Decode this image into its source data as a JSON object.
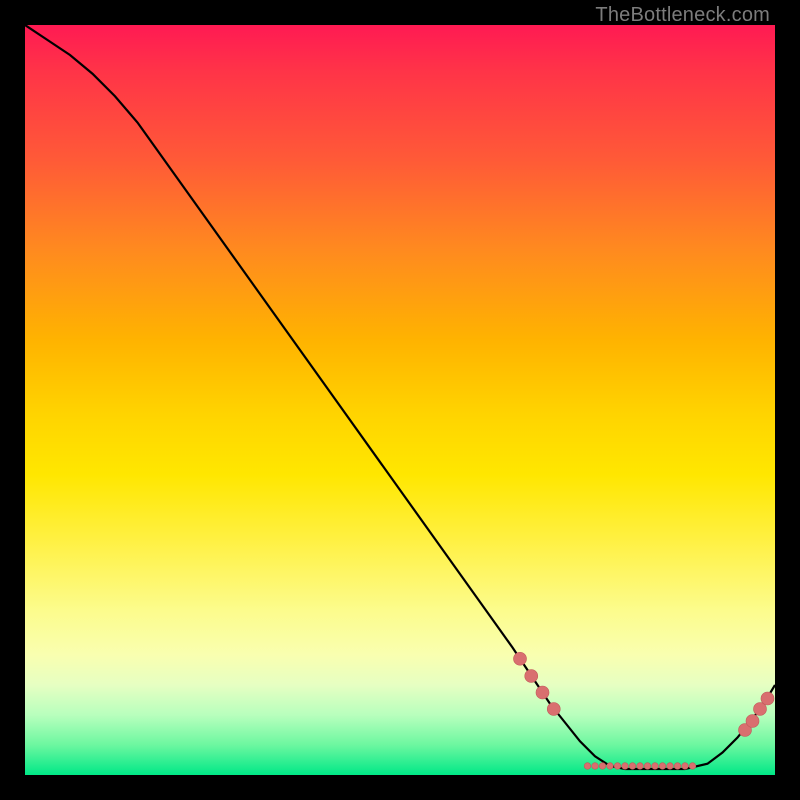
{
  "watermark": "TheBottleneck.com",
  "colors": {
    "curve_stroke": "#000000",
    "marker_fill": "#d96f6f",
    "marker_stroke": "#c15a5a"
  },
  "chart_data": {
    "type": "line",
    "title": "",
    "xlabel": "",
    "ylabel": "",
    "xlim": [
      0,
      100
    ],
    "ylim": [
      0,
      100
    ],
    "curve": [
      {
        "x": 0,
        "y": 100
      },
      {
        "x": 3,
        "y": 98
      },
      {
        "x": 6,
        "y": 96
      },
      {
        "x": 9,
        "y": 93.5
      },
      {
        "x": 12,
        "y": 90.5
      },
      {
        "x": 15,
        "y": 87
      },
      {
        "x": 20,
        "y": 80
      },
      {
        "x": 30,
        "y": 66
      },
      {
        "x": 40,
        "y": 52
      },
      {
        "x": 50,
        "y": 38
      },
      {
        "x": 60,
        "y": 24
      },
      {
        "x": 65,
        "y": 17
      },
      {
        "x": 68,
        "y": 12.5
      },
      {
        "x": 70,
        "y": 9.5
      },
      {
        "x": 72,
        "y": 7
      },
      {
        "x": 74,
        "y": 4.5
      },
      {
        "x": 76,
        "y": 2.5
      },
      {
        "x": 78,
        "y": 1.2
      },
      {
        "x": 80,
        "y": 0.8
      },
      {
        "x": 84,
        "y": 0.8
      },
      {
        "x": 88,
        "y": 0.8
      },
      {
        "x": 91,
        "y": 1.5
      },
      {
        "x": 93,
        "y": 3
      },
      {
        "x": 95,
        "y": 5
      },
      {
        "x": 97,
        "y": 7.5
      },
      {
        "x": 98.5,
        "y": 9.5
      },
      {
        "x": 100,
        "y": 12
      }
    ],
    "markers_large": [
      {
        "x": 66,
        "y": 15.5
      },
      {
        "x": 67.5,
        "y": 13.2
      },
      {
        "x": 69,
        "y": 11
      },
      {
        "x": 70.5,
        "y": 8.8
      },
      {
        "x": 96,
        "y": 6
      },
      {
        "x": 97,
        "y": 7.2
      },
      {
        "x": 98,
        "y": 8.8
      },
      {
        "x": 99,
        "y": 10.2
      }
    ],
    "markers_small": [
      {
        "x": 75,
        "y": 1.2
      },
      {
        "x": 76,
        "y": 1.2
      },
      {
        "x": 77,
        "y": 1.2
      },
      {
        "x": 78,
        "y": 1.2
      },
      {
        "x": 79,
        "y": 1.2
      },
      {
        "x": 80,
        "y": 1.2
      },
      {
        "x": 81,
        "y": 1.2
      },
      {
        "x": 82,
        "y": 1.2
      },
      {
        "x": 83,
        "y": 1.2
      },
      {
        "x": 84,
        "y": 1.2
      },
      {
        "x": 85,
        "y": 1.2
      },
      {
        "x": 86,
        "y": 1.2
      },
      {
        "x": 87,
        "y": 1.2
      },
      {
        "x": 88,
        "y": 1.2
      },
      {
        "x": 89,
        "y": 1.2
      }
    ]
  }
}
